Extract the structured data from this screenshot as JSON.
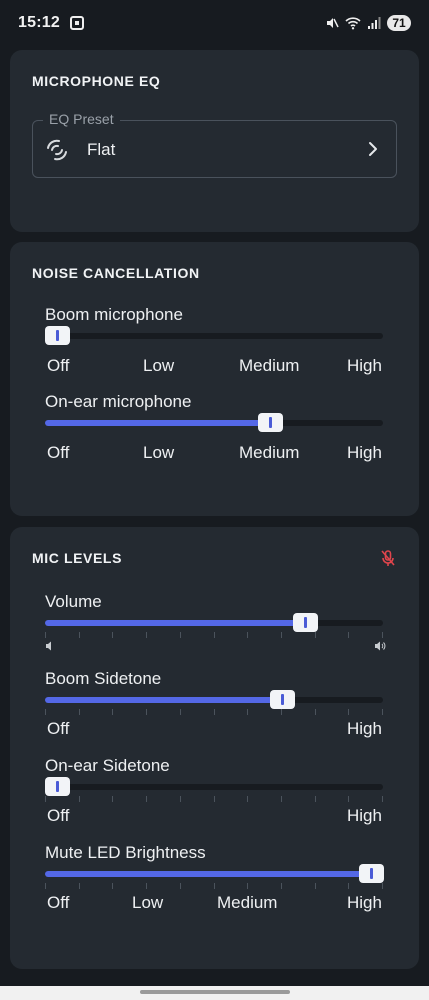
{
  "status_bar": {
    "time": "15:12",
    "battery": "71"
  },
  "eq": {
    "title": "MICROPHONE EQ",
    "preset_label": "EQ Preset",
    "preset_value": "Flat"
  },
  "noise": {
    "title": "NOISE CANCELLATION",
    "boom": {
      "label": "Boom microphone",
      "level": 0,
      "scale": [
        "Off",
        "Low",
        "Medium",
        "High"
      ]
    },
    "onear": {
      "label": "On-ear microphone",
      "level": 0.667,
      "scale": [
        "Off",
        "Low",
        "Medium",
        "High"
      ]
    }
  },
  "mic_levels": {
    "title": "MIC LEVELS",
    "volume": {
      "label": "Volume",
      "level": 0.77
    },
    "boom_sidetone": {
      "label": "Boom Sidetone",
      "level": 0.7,
      "scale": [
        "Off",
        "High"
      ]
    },
    "onear_sidetone": {
      "label": "On-ear Sidetone",
      "level": 0,
      "scale": [
        "Off",
        "High"
      ]
    },
    "mute_led": {
      "label": "Mute LED Brightness",
      "level": 1.0,
      "scale": [
        "Off",
        "Low",
        "Medium",
        "High"
      ]
    }
  },
  "colors": {
    "accent": "#5468e6",
    "mute_red": "#e0454c",
    "card": "#242a31",
    "background": "#171b20"
  },
  "icons": [
    "screenshot-icon",
    "silent-icon",
    "wifi-icon",
    "signal-icon",
    "battery-icon",
    "eq-preset-icon",
    "chevron-right-icon",
    "mic-muted-icon",
    "volume-low-icon",
    "volume-high-icon"
  ]
}
